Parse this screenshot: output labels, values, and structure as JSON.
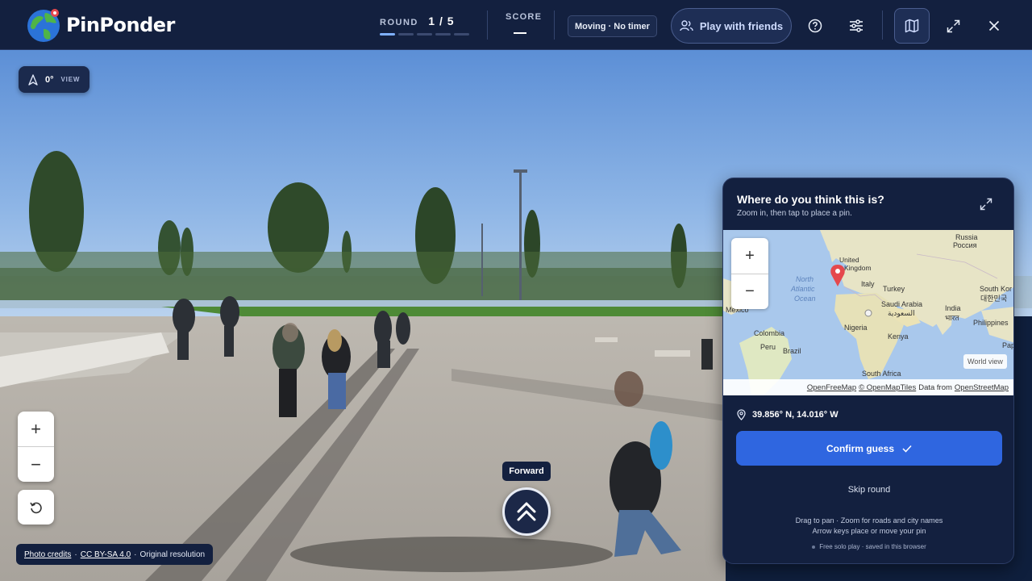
{
  "app": {
    "name": "PinPonder"
  },
  "header": {
    "round_label": "ROUND",
    "round_value": "1 / 5",
    "round_current": 1,
    "round_total": 5,
    "score_label": "SCORE",
    "mode_badge": "Moving · No timer",
    "friends_label": "Play with friends",
    "icons": [
      "help-icon",
      "settings-sliders-icon",
      "map-icon",
      "expand-icon",
      "close-icon"
    ]
  },
  "view": {
    "heading": "0°",
    "heading_label": "VIEW",
    "zoom_in": "+",
    "zoom_out": "−"
  },
  "credits": {
    "photo_credits": "Photo credits",
    "separator1": "·",
    "license": "CC BY-SA 4.0",
    "separator2": "·",
    "resolution": "Original resolution"
  },
  "navigation": {
    "forward_tooltip": "Forward"
  },
  "guess_panel": {
    "title": "Where do you think this is?",
    "subtitle": "Zoom in, then tap to place a pin.",
    "zoom_in": "+",
    "zoom_out": "−",
    "world_view": "World view",
    "attribution": {
      "ofm": "OpenFreeMap",
      "omt": "© OpenMapTiles",
      "data_from": "Data from",
      "osm": "OpenStreetMap"
    },
    "map_labels": {
      "russia": "Russia",
      "russia_local": "Россия",
      "united_kingdom_1": "United",
      "united_kingdom_2": "Kingdom",
      "north_atlantic_1": "North",
      "north_atlantic_2": "Atlantic",
      "north_atlantic_3": "Ocean",
      "italy": "Italy",
      "turkey": "Turkey",
      "south_korea": "South Kor",
      "south_korea_local": "대한민국",
      "mexico": "Mexico",
      "saudi_arabia": "Saudi Arabia",
      "saudi_arabia_local": "السعودية",
      "india": "India",
      "india_local": "भारत",
      "nigeria": "Nigeria",
      "philippines": "Philippines",
      "colombia": "Colombia",
      "kenya": "Kenya",
      "peru": "Peru",
      "brazil": "Brazil",
      "papua": "Pap",
      "south_africa": "South Africa"
    },
    "pin_coordinates": "39.856° N, 14.016° W",
    "confirm_label": "Confirm guess",
    "skip_label": "Skip round",
    "help_line1": "Drag to pan · Zoom for roads and city names",
    "help_line2": "Arrow keys place or move your pin",
    "solo_note": "Free solo play · saved in this browser"
  },
  "colors": {
    "topbar": "#13203f",
    "panel": "#13203f",
    "accent": "#2f66e0",
    "pin": "#e5484d",
    "ocean": "#a9c8ec",
    "land": "#e9e6c9"
  }
}
